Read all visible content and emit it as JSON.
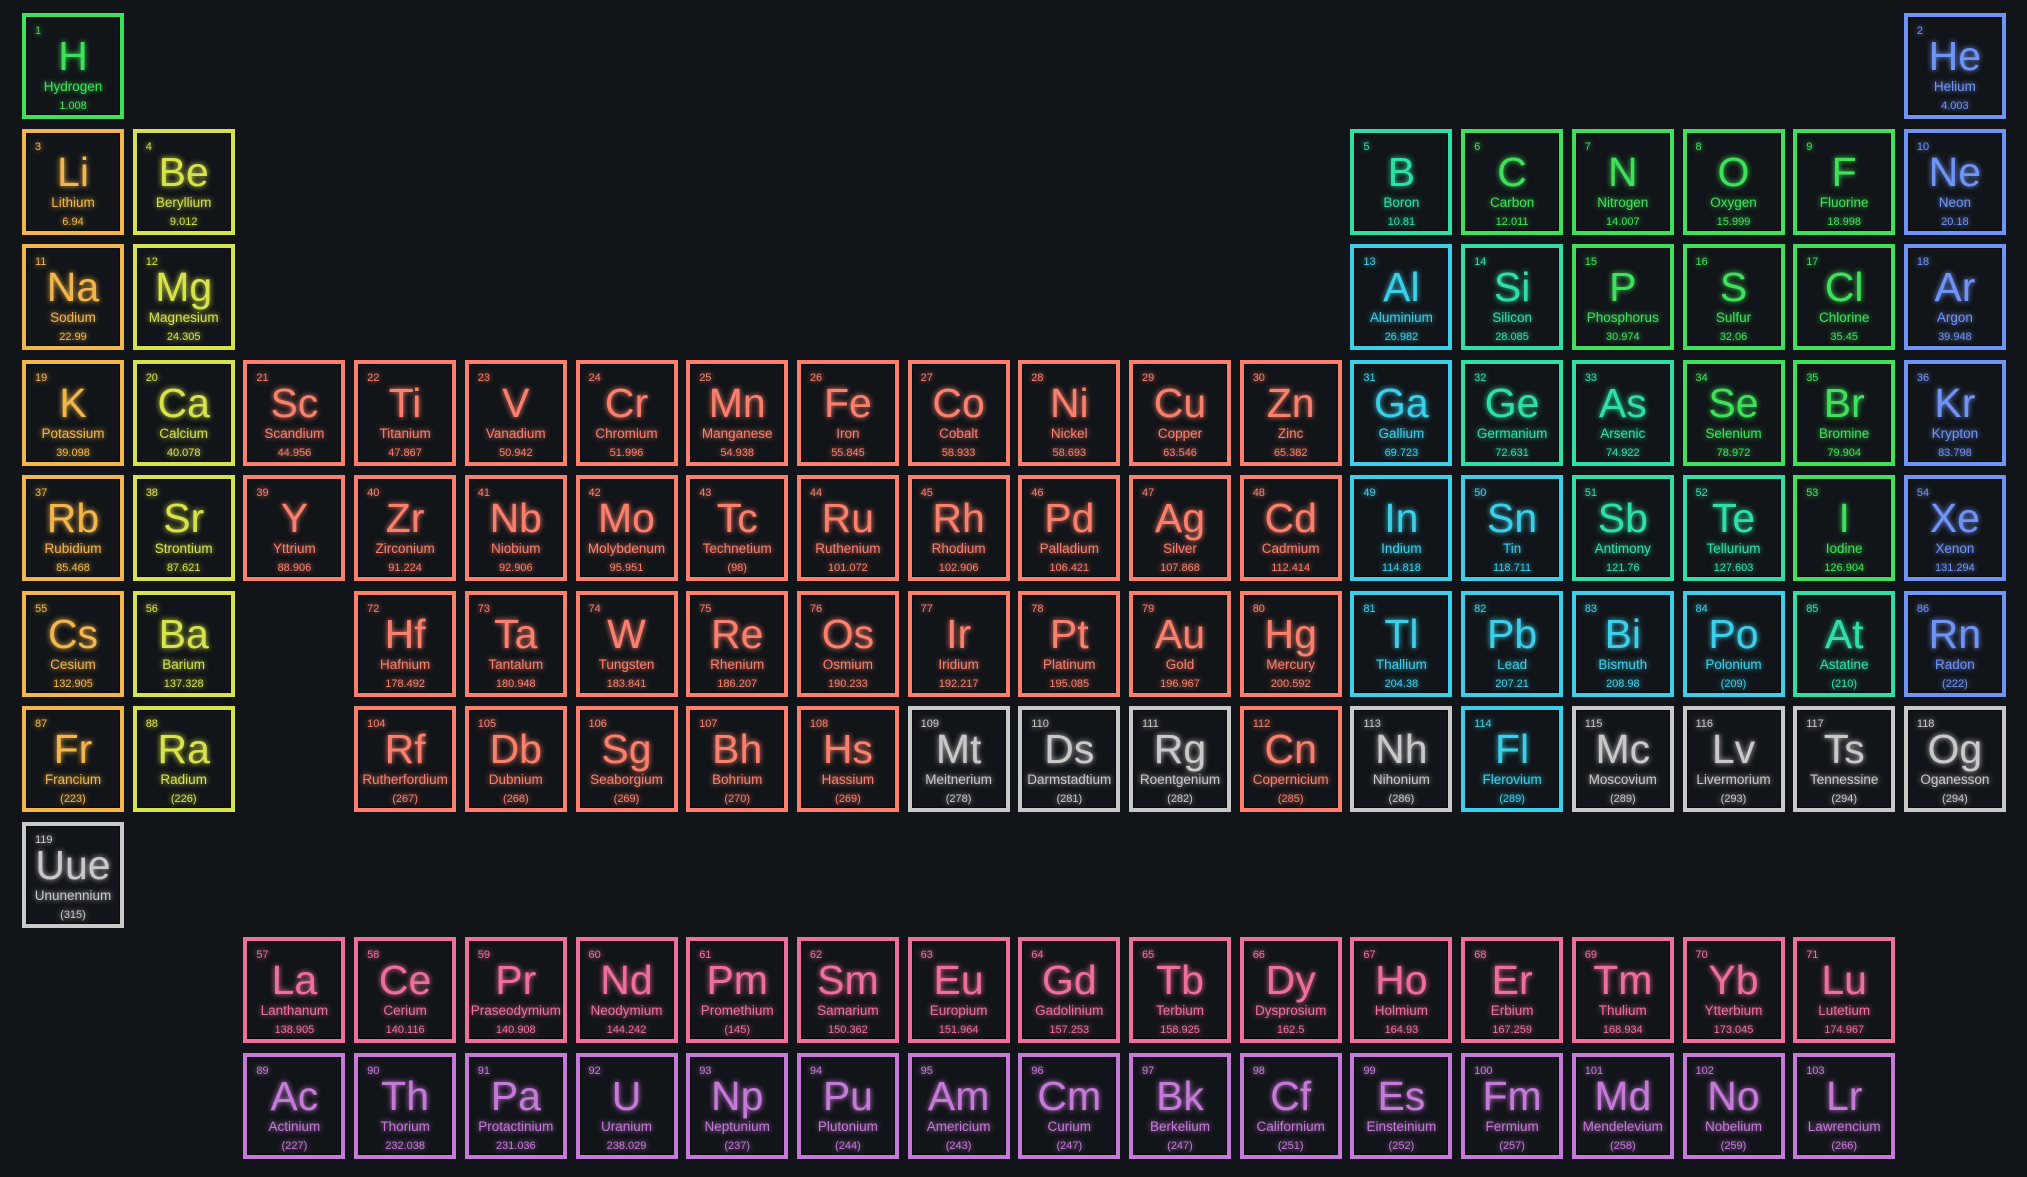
{
  "category_colors": {
    "nonmetal": "#3fe05a",
    "alkali": "#f2b64c",
    "alkaline": "#d6e34a",
    "transition": "#fa7f6c",
    "metalloid": "#2fe0a6",
    "post": "#3ccfe9",
    "noble": "#7094f5",
    "unknown": "#c9c9c9",
    "lanthanide": "#ef6f9b",
    "actinide": "#c47ad6"
  },
  "elements": [
    {
      "number": "1",
      "symbol": "H",
      "name": "Hydrogen",
      "weight": "1.008",
      "category": "nonmetal"
    },
    {
      "number": "2",
      "symbol": "He",
      "name": "Helium",
      "weight": "4.003",
      "category": "noble"
    },
    {
      "number": "3",
      "symbol": "Li",
      "name": "Lithium",
      "weight": "6.94",
      "category": "alkali"
    },
    {
      "number": "4",
      "symbol": "Be",
      "name": "Beryllium",
      "weight": "9.012",
      "category": "alkaline"
    },
    {
      "number": "5",
      "symbol": "B",
      "name": "Boron",
      "weight": "10.81",
      "category": "metalloid"
    },
    {
      "number": "6",
      "symbol": "C",
      "name": "Carbon",
      "weight": "12.011",
      "category": "nonmetal"
    },
    {
      "number": "7",
      "symbol": "N",
      "name": "Nitrogen",
      "weight": "14.007",
      "category": "nonmetal"
    },
    {
      "number": "8",
      "symbol": "O",
      "name": "Oxygen",
      "weight": "15.999",
      "category": "nonmetal"
    },
    {
      "number": "9",
      "symbol": "F",
      "name": "Fluorine",
      "weight": "18.998",
      "category": "nonmetal"
    },
    {
      "number": "10",
      "symbol": "Ne",
      "name": "Neon",
      "weight": "20.18",
      "category": "noble"
    },
    {
      "number": "11",
      "symbol": "Na",
      "name": "Sodium",
      "weight": "22.99",
      "category": "alkali"
    },
    {
      "number": "12",
      "symbol": "Mg",
      "name": "Magnesium",
      "weight": "24.305",
      "category": "alkaline"
    },
    {
      "number": "13",
      "symbol": "Al",
      "name": "Aluminium",
      "weight": "26.982",
      "category": "post"
    },
    {
      "number": "14",
      "symbol": "Si",
      "name": "Silicon",
      "weight": "28.085",
      "category": "metalloid"
    },
    {
      "number": "15",
      "symbol": "P",
      "name": "Phosphorus",
      "weight": "30.974",
      "category": "nonmetal"
    },
    {
      "number": "16",
      "symbol": "S",
      "name": "Sulfur",
      "weight": "32.06",
      "category": "nonmetal"
    },
    {
      "number": "17",
      "symbol": "Cl",
      "name": "Chlorine",
      "weight": "35.45",
      "category": "nonmetal"
    },
    {
      "number": "18",
      "symbol": "Ar",
      "name": "Argon",
      "weight": "39.948",
      "category": "noble"
    },
    {
      "number": "19",
      "symbol": "K",
      "name": "Potassium",
      "weight": "39.098",
      "category": "alkali"
    },
    {
      "number": "20",
      "symbol": "Ca",
      "name": "Calcium",
      "weight": "40.078",
      "category": "alkaline"
    },
    {
      "number": "21",
      "symbol": "Sc",
      "name": "Scandium",
      "weight": "44.956",
      "category": "transition"
    },
    {
      "number": "22",
      "symbol": "Ti",
      "name": "Titanium",
      "weight": "47.867",
      "category": "transition"
    },
    {
      "number": "23",
      "symbol": "V",
      "name": "Vanadium",
      "weight": "50.942",
      "category": "transition"
    },
    {
      "number": "24",
      "symbol": "Cr",
      "name": "Chromium",
      "weight": "51.996",
      "category": "transition"
    },
    {
      "number": "25",
      "symbol": "Mn",
      "name": "Manganese",
      "weight": "54.938",
      "category": "transition"
    },
    {
      "number": "26",
      "symbol": "Fe",
      "name": "Iron",
      "weight": "55.845",
      "category": "transition"
    },
    {
      "number": "27",
      "symbol": "Co",
      "name": "Cobalt",
      "weight": "58.933",
      "category": "transition"
    },
    {
      "number": "28",
      "symbol": "Ni",
      "name": "Nickel",
      "weight": "58.693",
      "category": "transition"
    },
    {
      "number": "29",
      "symbol": "Cu",
      "name": "Copper",
      "weight": "63.546",
      "category": "transition"
    },
    {
      "number": "30",
      "symbol": "Zn",
      "name": "Zinc",
      "weight": "65.382",
      "category": "transition"
    },
    {
      "number": "31",
      "symbol": "Ga",
      "name": "Gallium",
      "weight": "69.723",
      "category": "post"
    },
    {
      "number": "32",
      "symbol": "Ge",
      "name": "Germanium",
      "weight": "72.631",
      "category": "metalloid"
    },
    {
      "number": "33",
      "symbol": "As",
      "name": "Arsenic",
      "weight": "74.922",
      "category": "metalloid"
    },
    {
      "number": "34",
      "symbol": "Se",
      "name": "Selenium",
      "weight": "78.972",
      "category": "nonmetal"
    },
    {
      "number": "35",
      "symbol": "Br",
      "name": "Bromine",
      "weight": "79.904",
      "category": "nonmetal"
    },
    {
      "number": "36",
      "symbol": "Kr",
      "name": "Krypton",
      "weight": "83.798",
      "category": "noble"
    },
    {
      "number": "37",
      "symbol": "Rb",
      "name": "Rubidium",
      "weight": "85.468",
      "category": "alkali"
    },
    {
      "number": "38",
      "symbol": "Sr",
      "name": "Strontium",
      "weight": "87.621",
      "category": "alkaline"
    },
    {
      "number": "39",
      "symbol": "Y",
      "name": "Yttrium",
      "weight": "88.906",
      "category": "transition"
    },
    {
      "number": "40",
      "symbol": "Zr",
      "name": "Zirconium",
      "weight": "91.224",
      "category": "transition"
    },
    {
      "number": "41",
      "symbol": "Nb",
      "name": "Niobium",
      "weight": "92.906",
      "category": "transition"
    },
    {
      "number": "42",
      "symbol": "Mo",
      "name": "Molybdenum",
      "weight": "95.951",
      "category": "transition"
    },
    {
      "number": "43",
      "symbol": "Tc",
      "name": "Technetium",
      "weight": "(98)",
      "category": "transition"
    },
    {
      "number": "44",
      "symbol": "Ru",
      "name": "Ruthenium",
      "weight": "101.072",
      "category": "transition"
    },
    {
      "number": "45",
      "symbol": "Rh",
      "name": "Rhodium",
      "weight": "102.906",
      "category": "transition"
    },
    {
      "number": "46",
      "symbol": "Pd",
      "name": "Palladium",
      "weight": "106.421",
      "category": "transition"
    },
    {
      "number": "47",
      "symbol": "Ag",
      "name": "Silver",
      "weight": "107.868",
      "category": "transition"
    },
    {
      "number": "48",
      "symbol": "Cd",
      "name": "Cadmium",
      "weight": "112.414",
      "category": "transition"
    },
    {
      "number": "49",
      "symbol": "In",
      "name": "Indium",
      "weight": "114.818",
      "category": "post"
    },
    {
      "number": "50",
      "symbol": "Sn",
      "name": "Tin",
      "weight": "118.711",
      "category": "post"
    },
    {
      "number": "51",
      "symbol": "Sb",
      "name": "Antimony",
      "weight": "121.76",
      "category": "metalloid"
    },
    {
      "number": "52",
      "symbol": "Te",
      "name": "Tellurium",
      "weight": "127.603",
      "category": "metalloid"
    },
    {
      "number": "53",
      "symbol": "I",
      "name": "Iodine",
      "weight": "126.904",
      "category": "nonmetal"
    },
    {
      "number": "54",
      "symbol": "Xe",
      "name": "Xenon",
      "weight": "131.294",
      "category": "noble"
    },
    {
      "number": "55",
      "symbol": "Cs",
      "name": "Cesium",
      "weight": "132.905",
      "category": "alkali"
    },
    {
      "number": "56",
      "symbol": "Ba",
      "name": "Barium",
      "weight": "137.328",
      "category": "alkaline"
    },
    {
      "number": "57",
      "symbol": "La",
      "name": "Lanthanum",
      "weight": "138.905",
      "category": "lanthanide"
    },
    {
      "number": "58",
      "symbol": "Ce",
      "name": "Cerium",
      "weight": "140.116",
      "category": "lanthanide"
    },
    {
      "number": "59",
      "symbol": "Pr",
      "name": "Praseodymium",
      "weight": "140.908",
      "category": "lanthanide"
    },
    {
      "number": "60",
      "symbol": "Nd",
      "name": "Neodymium",
      "weight": "144.242",
      "category": "lanthanide"
    },
    {
      "number": "61",
      "symbol": "Pm",
      "name": "Promethium",
      "weight": "(145)",
      "category": "lanthanide"
    },
    {
      "number": "62",
      "symbol": "Sm",
      "name": "Samarium",
      "weight": "150.362",
      "category": "lanthanide"
    },
    {
      "number": "63",
      "symbol": "Eu",
      "name": "Europium",
      "weight": "151.964",
      "category": "lanthanide"
    },
    {
      "number": "64",
      "symbol": "Gd",
      "name": "Gadolinium",
      "weight": "157.253",
      "category": "lanthanide"
    },
    {
      "number": "65",
      "symbol": "Tb",
      "name": "Terbium",
      "weight": "158.925",
      "category": "lanthanide"
    },
    {
      "number": "66",
      "symbol": "Dy",
      "name": "Dysprosium",
      "weight": "162.5",
      "category": "lanthanide"
    },
    {
      "number": "67",
      "symbol": "Ho",
      "name": "Holmium",
      "weight": "164.93",
      "category": "lanthanide"
    },
    {
      "number": "68",
      "symbol": "Er",
      "name": "Erbium",
      "weight": "167.259",
      "category": "lanthanide"
    },
    {
      "number": "69",
      "symbol": "Tm",
      "name": "Thulium",
      "weight": "168.934",
      "category": "lanthanide"
    },
    {
      "number": "70",
      "symbol": "Yb",
      "name": "Ytterbium",
      "weight": "173.045",
      "category": "lanthanide"
    },
    {
      "number": "71",
      "symbol": "Lu",
      "name": "Lutetium",
      "weight": "174.967",
      "category": "lanthanide"
    },
    {
      "number": "72",
      "symbol": "Hf",
      "name": "Hafnium",
      "weight": "178.492",
      "category": "transition"
    },
    {
      "number": "73",
      "symbol": "Ta",
      "name": "Tantalum",
      "weight": "180.948",
      "category": "transition"
    },
    {
      "number": "74",
      "symbol": "W",
      "name": "Tungsten",
      "weight": "183.841",
      "category": "transition"
    },
    {
      "number": "75",
      "symbol": "Re",
      "name": "Rhenium",
      "weight": "186.207",
      "category": "transition"
    },
    {
      "number": "76",
      "symbol": "Os",
      "name": "Osmium",
      "weight": "190.233",
      "category": "transition"
    },
    {
      "number": "77",
      "symbol": "Ir",
      "name": "Iridium",
      "weight": "192.217",
      "category": "transition"
    },
    {
      "number": "78",
      "symbol": "Pt",
      "name": "Platinum",
      "weight": "195.085",
      "category": "transition"
    },
    {
      "number": "79",
      "symbol": "Au",
      "name": "Gold",
      "weight": "196.967",
      "category": "transition"
    },
    {
      "number": "80",
      "symbol": "Hg",
      "name": "Mercury",
      "weight": "200.592",
      "category": "transition"
    },
    {
      "number": "81",
      "symbol": "Tl",
      "name": "Thallium",
      "weight": "204.38",
      "category": "post"
    },
    {
      "number": "82",
      "symbol": "Pb",
      "name": "Lead",
      "weight": "207.21",
      "category": "post"
    },
    {
      "number": "83",
      "symbol": "Bi",
      "name": "Bismuth",
      "weight": "208.98",
      "category": "post"
    },
    {
      "number": "84",
      "symbol": "Po",
      "name": "Polonium",
      "weight": "(209)",
      "category": "post"
    },
    {
      "number": "85",
      "symbol": "At",
      "name": "Astatine",
      "weight": "(210)",
      "category": "metalloid"
    },
    {
      "number": "86",
      "symbol": "Rn",
      "name": "Radon",
      "weight": "(222)",
      "category": "noble"
    },
    {
      "number": "87",
      "symbol": "Fr",
      "name": "Francium",
      "weight": "(223)",
      "category": "alkali"
    },
    {
      "number": "88",
      "symbol": "Ra",
      "name": "Radium",
      "weight": "(226)",
      "category": "alkaline"
    },
    {
      "number": "89",
      "symbol": "Ac",
      "name": "Actinium",
      "weight": "(227)",
      "category": "actinide"
    },
    {
      "number": "90",
      "symbol": "Th",
      "name": "Thorium",
      "weight": "232.038",
      "category": "actinide"
    },
    {
      "number": "91",
      "symbol": "Pa",
      "name": "Protactinium",
      "weight": "231.036",
      "category": "actinide"
    },
    {
      "number": "92",
      "symbol": "U",
      "name": "Uranium",
      "weight": "238.029",
      "category": "actinide"
    },
    {
      "number": "93",
      "symbol": "Np",
      "name": "Neptunium",
      "weight": "(237)",
      "category": "actinide"
    },
    {
      "number": "94",
      "symbol": "Pu",
      "name": "Plutonium",
      "weight": "(244)",
      "category": "actinide"
    },
    {
      "number": "95",
      "symbol": "Am",
      "name": "Americium",
      "weight": "(243)",
      "category": "actinide"
    },
    {
      "number": "96",
      "symbol": "Cm",
      "name": "Curium",
      "weight": "(247)",
      "category": "actinide"
    },
    {
      "number": "97",
      "symbol": "Bk",
      "name": "Berkelium",
      "weight": "(247)",
      "category": "actinide"
    },
    {
      "number": "98",
      "symbol": "Cf",
      "name": "Californium",
      "weight": "(251)",
      "category": "actinide"
    },
    {
      "number": "99",
      "symbol": "Es",
      "name": "Einsteinium",
      "weight": "(252)",
      "category": "actinide"
    },
    {
      "number": "100",
      "symbol": "Fm",
      "name": "Fermium",
      "weight": "(257)",
      "category": "actinide"
    },
    {
      "number": "101",
      "symbol": "Md",
      "name": "Mendelevium",
      "weight": "(258)",
      "category": "actinide"
    },
    {
      "number": "102",
      "symbol": "No",
      "name": "Nobelium",
      "weight": "(259)",
      "category": "actinide"
    },
    {
      "number": "103",
      "symbol": "Lr",
      "name": "Lawrencium",
      "weight": "(266)",
      "category": "actinide"
    },
    {
      "number": "104",
      "symbol": "Rf",
      "name": "Rutherfordium",
      "weight": "(267)",
      "category": "transition"
    },
    {
      "number": "105",
      "symbol": "Db",
      "name": "Dubnium",
      "weight": "(268)",
      "category": "transition"
    },
    {
      "number": "106",
      "symbol": "Sg",
      "name": "Seaborgium",
      "weight": "(269)",
      "category": "transition"
    },
    {
      "number": "107",
      "symbol": "Bh",
      "name": "Bohrium",
      "weight": "(270)",
      "category": "transition"
    },
    {
      "number": "108",
      "symbol": "Hs",
      "name": "Hassium",
      "weight": "(269)",
      "category": "transition"
    },
    {
      "number": "109",
      "symbol": "Mt",
      "name": "Meitnerium",
      "weight": "(278)",
      "category": "unknown"
    },
    {
      "number": "110",
      "symbol": "Ds",
      "name": "Darmstadtium",
      "weight": "(281)",
      "category": "unknown"
    },
    {
      "number": "111",
      "symbol": "Rg",
      "name": "Roentgenium",
      "weight": "(282)",
      "category": "unknown"
    },
    {
      "number": "112",
      "symbol": "Cn",
      "name": "Copernicium",
      "weight": "(285)",
      "category": "transition"
    },
    {
      "number": "113",
      "symbol": "Nh",
      "name": "Nihonium",
      "weight": "(286)",
      "category": "unknown"
    },
    {
      "number": "114",
      "symbol": "Fl",
      "name": "Flerovium",
      "weight": "(289)",
      "category": "post"
    },
    {
      "number": "115",
      "symbol": "Mc",
      "name": "Moscovium",
      "weight": "(289)",
      "category": "unknown"
    },
    {
      "number": "116",
      "symbol": "Lv",
      "name": "Livermorium",
      "weight": "(293)",
      "category": "unknown"
    },
    {
      "number": "117",
      "symbol": "Ts",
      "name": "Tennessine",
      "weight": "(294)",
      "category": "unknown"
    },
    {
      "number": "118",
      "symbol": "Og",
      "name": "Oganesson",
      "weight": "(294)",
      "category": "unknown"
    },
    {
      "number": "119",
      "symbol": "Uue",
      "name": "Ununennium",
      "weight": "(315)",
      "category": "unknown"
    }
  ]
}
